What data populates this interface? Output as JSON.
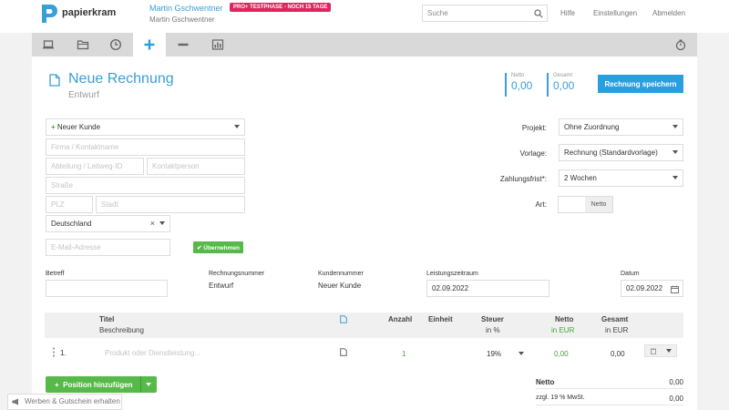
{
  "header": {
    "brand": "papierkram",
    "user_name": "Martin Gschwentner",
    "user_sub": "Martin Gschwentner",
    "badge": "PRO+ TESTPHASE - NOCH 15 TAGE",
    "search_placeholder": "Suche",
    "links": [
      "Hilfe",
      "Einstellungen",
      "Abmelden"
    ]
  },
  "nav": {
    "tabs": [
      "laptop-icon",
      "folder-icon",
      "clock-icon",
      "plus-icon",
      "minus-icon",
      "chart-icon"
    ],
    "active_tab": "plus-icon",
    "right_icon": "stopwatch-icon"
  },
  "invoice": {
    "title": "Neue Rechnung",
    "status": "Entwurf",
    "netto_label": "Netto",
    "netto_value": "0,00",
    "gesamt_label": "Gesamt",
    "gesamt_value": "0,00",
    "save_label": "Rechnung speichern"
  },
  "customer": {
    "select_value": "Neuer Kunde",
    "company_placeholder": "Firma / Kontaktname",
    "department_placeholder": "Abteilung / Leitweg-ID",
    "contact_placeholder": "Kontaktperson",
    "street_placeholder": "Straße",
    "zip_placeholder": "PLZ",
    "city_placeholder": "Stadt",
    "country_value": "Deutschland",
    "email_placeholder": "E-Mail-Adresse",
    "apply_label": "Übernehmen"
  },
  "settings": {
    "project_label": "Projekt:",
    "project_value": "Ohne Zuordnung",
    "template_label": "Vorlage:",
    "template_value": "Rechnung (Standardvorlage)",
    "payment_label": "Zahlungsfrist*:",
    "payment_value": "2 Wochen",
    "type_label": "Art:",
    "type_value": "Netto"
  },
  "meta": {
    "subject_label": "Betreff",
    "subject_value": "",
    "invoice_no_label": "Rechnungsnummer",
    "invoice_no_value": "Entwurf",
    "customer_no_label": "Kundennummer",
    "customer_no_value": "Neuer Kunde",
    "period_label": "Leistungszeitraum",
    "period_value": "02.09.2022",
    "date_label": "Datum",
    "date_value": "02.09.2022"
  },
  "table": {
    "headers": {
      "title": "Titel",
      "description": "Beschreibung",
      "quantity": "Anzahl",
      "unit": "Einheit",
      "tax": "Steuer",
      "tax_unit": "in %",
      "net": "Netto",
      "net_unit": "in EUR",
      "total": "Gesamt",
      "total_unit": "in EUR"
    },
    "rows": [
      {
        "number": "1.",
        "placeholder": "Produkt oder Dienstleistung...",
        "quantity": "1",
        "tax": "19%",
        "net": "0,00",
        "total": "0,00"
      }
    ],
    "add_position_label": "Position hinzufügen"
  },
  "totals": {
    "net_label": "Netto",
    "net_value": "0,00",
    "vat_label": "zzgl. 19 % MwSt.",
    "vat_value": "0,00"
  },
  "feedback_label": "Werben & Gutschein erhalten",
  "colors": {
    "accent": "#3a9fd6",
    "save_button": "#2a9fe0",
    "green": "#56b949",
    "badge": "#e0245e"
  }
}
